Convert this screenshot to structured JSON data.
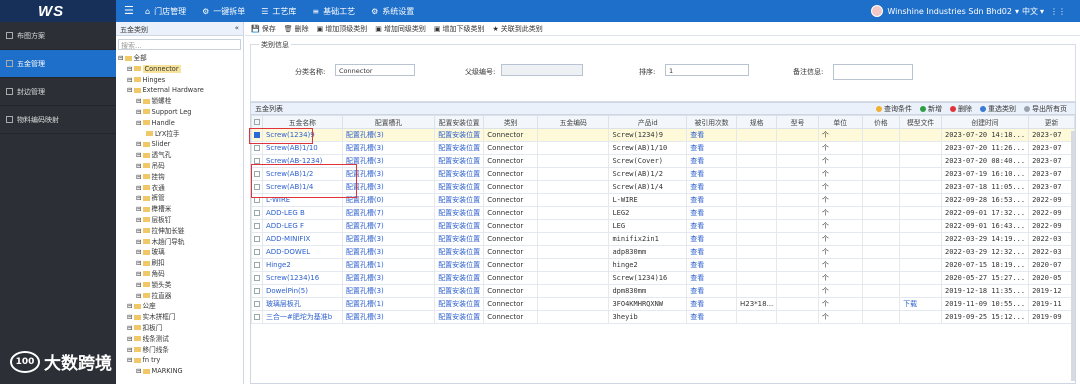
{
  "brand": "WS",
  "topnav": [
    "门店管理",
    "一键拆单",
    "工艺库",
    "基础工艺",
    "系统设置"
  ],
  "user": {
    "name": "Winshine Industries Sdn Bhd02",
    "lang": "中文"
  },
  "sidebar": [
    {
      "label": "布图方案",
      "active": false
    },
    {
      "label": "五金管理",
      "active": true
    },
    {
      "label": "封边管理",
      "active": false
    },
    {
      "label": "物料编码映射",
      "active": false
    }
  ],
  "tree": {
    "title": "五金类别",
    "search": "搜索...",
    "nodes": [
      {
        "t": "全部",
        "d": 0
      },
      {
        "t": "Connector",
        "d": 1,
        "sel": true
      },
      {
        "t": "Hinges",
        "d": 1
      },
      {
        "t": "External Hardware",
        "d": 1
      },
      {
        "t": "锁螺栓",
        "d": 2
      },
      {
        "t": "Support Leg",
        "d": 2
      },
      {
        "t": "Handle",
        "d": 2
      },
      {
        "t": "LYX拉手",
        "d": 3
      },
      {
        "t": "Slider",
        "d": 2
      },
      {
        "t": "透气孔",
        "d": 2
      },
      {
        "t": "吊码",
        "d": 2
      },
      {
        "t": "挂钩",
        "d": 2
      },
      {
        "t": "衣通",
        "d": 2
      },
      {
        "t": "裤管",
        "d": 2
      },
      {
        "t": "榫槽米",
        "d": 2
      },
      {
        "t": "层板钉",
        "d": 2
      },
      {
        "t": "拉伸加长链",
        "d": 2
      },
      {
        "t": "木趟门导轨",
        "d": 2
      },
      {
        "t": "玻璃",
        "d": 2
      },
      {
        "t": "刷扣",
        "d": 2
      },
      {
        "t": "角码",
        "d": 2
      },
      {
        "t": "锁头类",
        "d": 2
      },
      {
        "t": "拉直器",
        "d": 2
      },
      {
        "t": "公座",
        "d": 1
      },
      {
        "t": "实木拼框门",
        "d": 1
      },
      {
        "t": "扣板门",
        "d": 1
      },
      {
        "t": "线条测试",
        "d": 1
      },
      {
        "t": "移门线条",
        "d": 1
      },
      {
        "t": "fn try",
        "d": 1
      },
      {
        "t": "MARKING",
        "d": 2
      }
    ]
  },
  "toolbar": [
    "保存",
    "删除",
    "增加顶级类别",
    "增加同级类别",
    "增加下级类别",
    "关联到此类别"
  ],
  "form": {
    "legend": "类别信息",
    "fields": [
      {
        "label": "分类名称:",
        "value": "Connector"
      },
      {
        "label": "父级编号:",
        "value": ""
      },
      {
        "label": "排序:",
        "value": "1"
      },
      {
        "label": "备注信息:",
        "value": ""
      }
    ]
  },
  "grid": {
    "title": "五金列表",
    "tools": [
      {
        "label": "查询条件",
        "color": "#f0b030"
      },
      {
        "label": "新增",
        "color": "#2f9e44"
      },
      {
        "label": "删除",
        "color": "#e0343a"
      },
      {
        "label": "重选类别",
        "color": "#3a7bd5"
      },
      {
        "label": "导出所有页",
        "color": "#9aa3ad"
      }
    ],
    "columns": [
      "",
      "五金名称",
      "配置槽孔",
      "配置安装位置",
      "类别",
      "五金编码",
      "产品id",
      "被引用次数",
      "规格",
      "型号",
      "单位",
      "价格",
      "模型文件",
      "创建时间",
      "更新"
    ],
    "rows": [
      [
        "Screw(1234)9",
        "配置孔槽(3)",
        "配置安装位置",
        "Connector",
        "",
        "Screw(1234)9",
        "查看",
        "",
        "",
        "个",
        "",
        "",
        "2023-07-20 14:18...",
        "2023-07"
      ],
      [
        "Screw(AB)1/10",
        "配置孔槽(3)",
        "配置安装位置",
        "Connector",
        "",
        "Screw(AB)1/10",
        "查看",
        "",
        "",
        "个",
        "",
        "",
        "2023-07-20 11:26...",
        "2023-07"
      ],
      [
        "Screw(AB-1234)",
        "配置孔槽(3)",
        "配置安装位置",
        "Connector",
        "",
        "Screw(Cover)",
        "查看",
        "",
        "",
        "个",
        "",
        "",
        "2023-07-20 08:40...",
        "2023-07"
      ],
      [
        "Screw(AB)1/2",
        "配置孔槽(3)",
        "配置安装位置",
        "Connector",
        "",
        "Screw(AB)1/2",
        "查看",
        "",
        "",
        "个",
        "",
        "",
        "2023-07-19 16:10...",
        "2023-07"
      ],
      [
        "Screw(AB)1/4",
        "配置孔槽(3)",
        "配置安装位置",
        "Connector",
        "",
        "Screw(AB)1/4",
        "查看",
        "",
        "",
        "个",
        "",
        "",
        "2023-07-18 11:05...",
        "2023-07"
      ],
      [
        "L-WIRE",
        "配置孔槽(0)",
        "配置安装位置",
        "Connector",
        "",
        "L-WIRE",
        "查看",
        "",
        "",
        "个",
        "",
        "",
        "2022-09-28 16:53...",
        "2022-09"
      ],
      [
        "ADD-LEG B",
        "配置孔槽(7)",
        "配置安装位置",
        "Connector",
        "",
        "LEG2",
        "查看",
        "",
        "",
        "个",
        "",
        "",
        "2022-09-01 17:32...",
        "2022-09"
      ],
      [
        "ADD-LEG F",
        "配置孔槽(7)",
        "配置安装位置",
        "Connector",
        "",
        "LEG",
        "查看",
        "",
        "",
        "个",
        "",
        "",
        "2022-09-01 16:43...",
        "2022-09"
      ],
      [
        "ADD-MINIFIX",
        "配置孔槽(3)",
        "配置安装位置",
        "Connector",
        "",
        "minifix2in1",
        "查看",
        "",
        "",
        "个",
        "",
        "",
        "2022-03-29 14:19...",
        "2022-03"
      ],
      [
        "ADD-DOWEL",
        "配置孔槽(3)",
        "配置安装位置",
        "Connector",
        "",
        "adp830mm",
        "查看",
        "",
        "",
        "个",
        "",
        "",
        "2022-03-29 12:32...",
        "2022-03"
      ],
      [
        "Hinge2",
        "配置孔槽(1)",
        "配置安装位置",
        "Connector",
        "",
        "hinge2",
        "查看",
        "",
        "",
        "个",
        "",
        "",
        "2020-07-15 18:19...",
        "2020-07"
      ],
      [
        "Screw(1234)16",
        "配置孔槽(3)",
        "配置安装位置",
        "Connector",
        "",
        "Screw(1234)16",
        "查看",
        "",
        "",
        "个",
        "",
        "",
        "2020-05-27 15:27...",
        "2020-05"
      ],
      [
        "DowelPin(5)",
        "配置孔槽(3)",
        "配置安装位置",
        "Connector",
        "",
        "dpm830mm",
        "查看",
        "",
        "",
        "个",
        "",
        "",
        "2019-12-18 11:35...",
        "2019-12"
      ],
      [
        "玻璃层板孔",
        "配置孔槽(1)",
        "配置安装位置",
        "Connector",
        "",
        "3FO4KMHRQXNW",
        "查看",
        "H23*18...",
        "",
        "个",
        "",
        "下载",
        "2019-11-09 10:55...",
        "2019-11"
      ],
      [
        "三合一#肥坨为基准b",
        "配置孔槽(3)",
        "配置安装位置",
        "Connector",
        "",
        "3heyib",
        "查看",
        "",
        "",
        "个",
        "",
        "",
        "2019-09-25 15:12...",
        "2019-09"
      ]
    ]
  },
  "watermark": "大数跨境"
}
